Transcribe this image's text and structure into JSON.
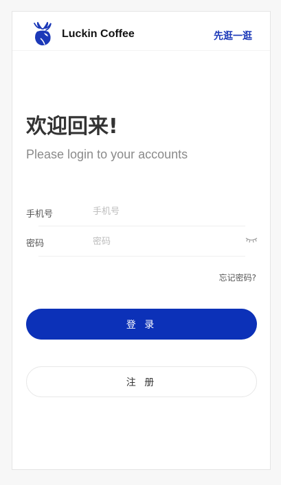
{
  "header": {
    "logo_icon": "deer-logo-icon",
    "brand": "Luckin Coffee",
    "browse_link": "先逛一逛"
  },
  "welcome": {
    "title": "欢迎回来!",
    "subtitle": "Please login to your accounts"
  },
  "form": {
    "phone": {
      "label": "手机号",
      "placeholder": "手机号",
      "value": ""
    },
    "password": {
      "label": "密码",
      "placeholder": "密码",
      "value": "",
      "toggle_icon": "eye-closed-icon"
    },
    "forgot": "忘记密码?",
    "login_label": "登 录",
    "register_label": "注 册"
  },
  "colors": {
    "accent": "#0c31b8",
    "link": "#1c39b8",
    "background": "#f7f7f7",
    "card": "#ffffff",
    "text_dark": "#333333",
    "text_muted": "#8a8a8a"
  }
}
